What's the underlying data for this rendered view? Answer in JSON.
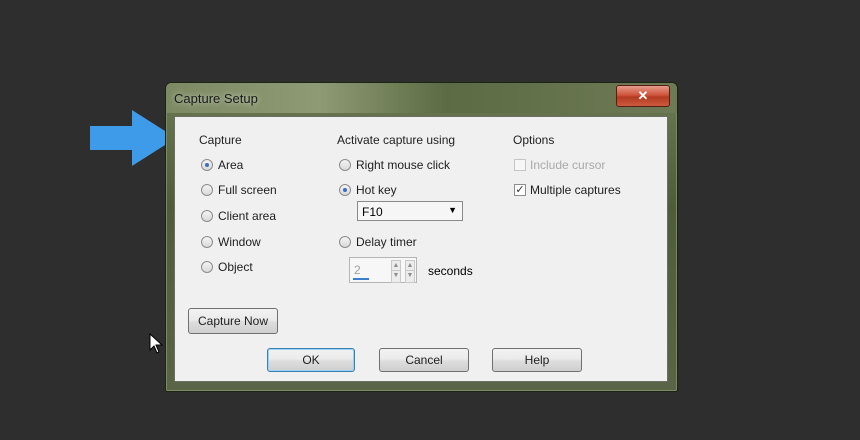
{
  "dialog": {
    "title": "Capture Setup",
    "close_label": "✕",
    "capture": {
      "title": "Capture",
      "options": [
        {
          "label": "Area",
          "checked": true
        },
        {
          "label": "Full screen",
          "checked": false
        },
        {
          "label": "Client area",
          "checked": false
        },
        {
          "label": "Window",
          "checked": false
        },
        {
          "label": "Object",
          "checked": false
        }
      ]
    },
    "activate": {
      "title": "Activate capture using",
      "right_click_label": "Right mouse click",
      "hot_key_label": "Hot key",
      "hot_key_value": "F10",
      "delay_timer_label": "Delay timer",
      "delay_value": "2",
      "seconds_label": "seconds"
    },
    "options": {
      "title": "Options",
      "include_cursor_label": "Include cursor",
      "multiple_captures_label": "Multiple captures"
    },
    "buttons": {
      "capture_now": "Capture Now",
      "ok": "OK",
      "cancel": "Cancel",
      "help": "Help"
    }
  },
  "colors": {
    "highlight_arrow": "#3d9be9",
    "background": "#2e2e2e",
    "radio_accent": "#3a6fc2"
  },
  "icons": {
    "pointer_arrow": "arrow-right-icon",
    "mouse_cursor": "mouse-cursor-icon",
    "check_mark": "✓"
  }
}
